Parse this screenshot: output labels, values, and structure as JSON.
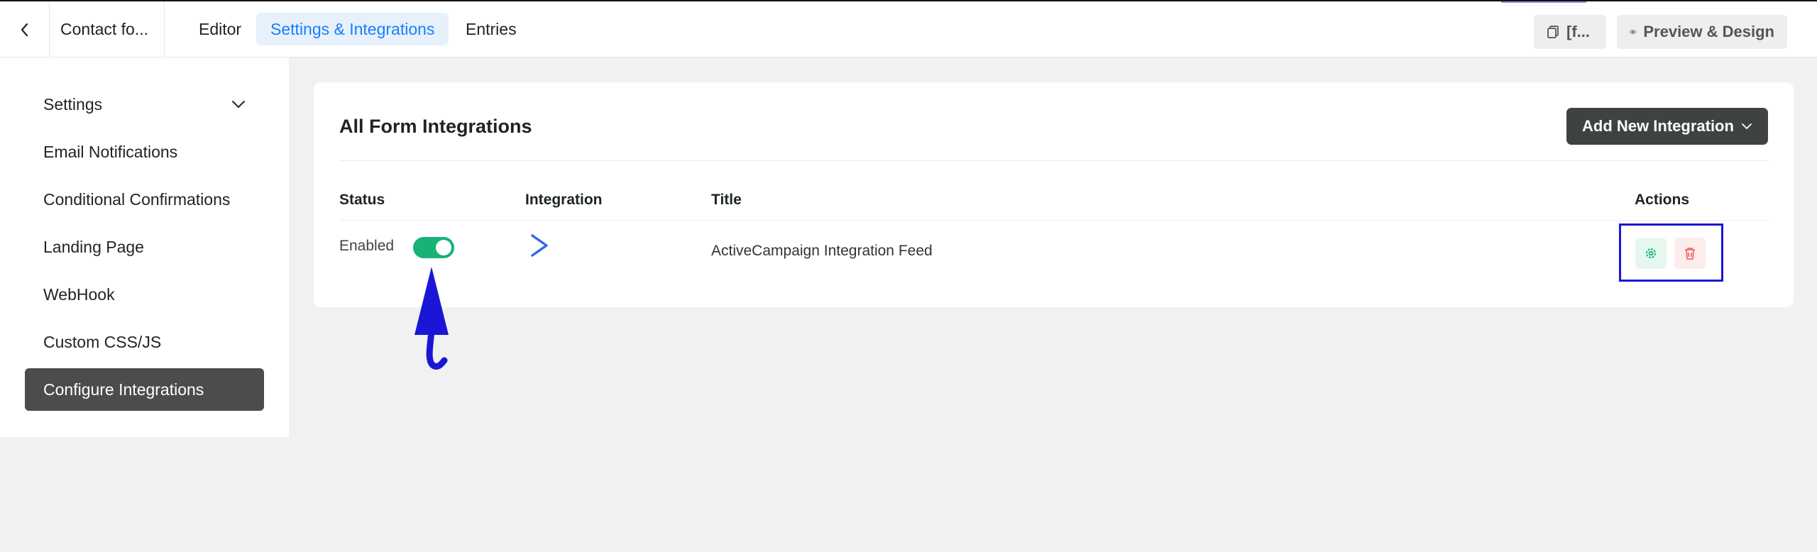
{
  "topbar": {
    "form_name": "Contact fo...",
    "tabs": [
      {
        "label": "Editor",
        "active": false
      },
      {
        "label": "Settings & Integrations",
        "active": true
      },
      {
        "label": "Entries",
        "active": false
      }
    ],
    "shortcode_label": "[f...",
    "preview_label": "Preview & Design",
    "icons": {
      "back": "chevron-left-icon",
      "shortcode": "copy-icon",
      "preview": "eye-icon"
    }
  },
  "sidebar": {
    "items": [
      {
        "label": "Settings",
        "has_chevron": true,
        "active": false
      },
      {
        "label": "Email Notifications",
        "active": false
      },
      {
        "label": "Conditional Confirmations",
        "active": false
      },
      {
        "label": "Landing Page",
        "active": false
      },
      {
        "label": "WebHook",
        "active": false
      },
      {
        "label": "Custom CSS/JS",
        "active": false
      },
      {
        "label": "Configure Integrations",
        "active": true
      }
    ]
  },
  "main": {
    "title": "All Form Integrations",
    "add_button_label": "Add New Integration",
    "table": {
      "headers": {
        "status": "Status",
        "integration": "Integration",
        "title": "Title",
        "actions": "Actions"
      },
      "rows": [
        {
          "status": "Enabled",
          "enabled": true,
          "integration_icon": "activecampaign-icon",
          "title": "ActiveCampaign Integration Feed"
        }
      ]
    }
  },
  "colors": {
    "accent": "#1a7efb",
    "toggle_on": "#19b276",
    "sidebar_active": "#4b4c4d",
    "annotation": "#1b16d6"
  }
}
